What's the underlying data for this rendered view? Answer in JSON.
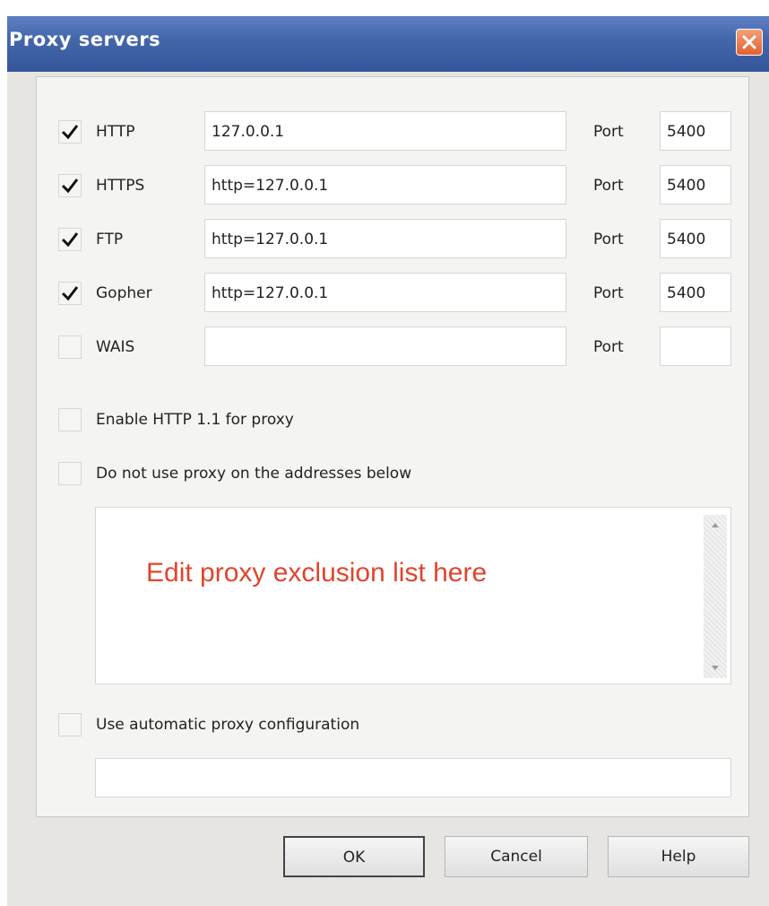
{
  "window": {
    "title": "Proxy servers"
  },
  "proxies": [
    {
      "checked": true,
      "label": "HTTP",
      "address": "127.0.0.1",
      "port_label": "Port",
      "port": "5400"
    },
    {
      "checked": true,
      "label": "HTTPS",
      "address": "http=127.0.0.1",
      "port_label": "Port",
      "port": "5400"
    },
    {
      "checked": true,
      "label": "FTP",
      "address": "http=127.0.0.1",
      "port_label": "Port",
      "port": "5400"
    },
    {
      "checked": true,
      "label": "Gopher",
      "address": "http=127.0.0.1",
      "port_label": "Port",
      "port": "5400"
    },
    {
      "checked": false,
      "label": "WAIS",
      "address": "",
      "port_label": "Port",
      "port": ""
    }
  ],
  "options": {
    "enable_http11": {
      "checked": false,
      "label": "Enable HTTP 1.1 for proxy"
    },
    "bypass": {
      "checked": false,
      "label": "Do not use proxy on the addresses below"
    },
    "exclusion_list": {
      "value": "",
      "overlay_text": "Edit proxy exclusion list here",
      "overlay_color": "#e0452c"
    },
    "auto_config": {
      "checked": false,
      "label": "Use automatic proxy configuration",
      "url": ""
    }
  },
  "buttons": {
    "ok": "OK",
    "cancel": "Cancel",
    "help": "Help"
  },
  "colors": {
    "titlebar": "#4467ac",
    "close": "#e2602e",
    "panel": "#f4f4f2"
  }
}
